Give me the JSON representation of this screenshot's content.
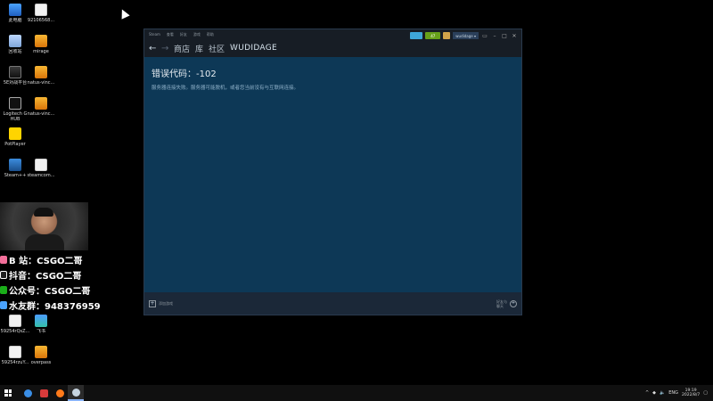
{
  "desktop": {
    "icons": [
      {
        "label": "此电脑",
        "icon": "computer-icon"
      },
      {
        "label": "92106568...",
        "icon": "document-icon"
      },
      {
        "label": "回收站",
        "icon": "recycle-bin-icon"
      },
      {
        "label": "mirage",
        "icon": "csgo-icon"
      },
      {
        "label": "5E对战平台",
        "icon": "5e-icon"
      },
      {
        "label": "natus-vinc...",
        "icon": "csgo-icon"
      },
      {
        "label": "Logitech G HUB",
        "icon": "logitech-icon"
      },
      {
        "label": "natus-vinc...",
        "icon": "csgo-icon"
      },
      {
        "label": "PotPlayer",
        "icon": "potplayer-icon"
      },
      {
        "label": "Steam++",
        "icon": "steampp-icon"
      },
      {
        "label": "steamcom...",
        "icon": "document-icon"
      },
      {
        "label": "59254rQsZ...",
        "icon": "document-icon"
      },
      {
        "label": "飞书",
        "icon": "feishu-icon"
      },
      {
        "label": "59254rzuY...",
        "icon": "document-icon"
      },
      {
        "label": "overpass",
        "icon": "csgo-icon"
      }
    ]
  },
  "steam": {
    "menu": [
      "Steam",
      "查看",
      "好友",
      "游戏",
      "帮助"
    ],
    "notification_count": "47",
    "account_name": "wudidage",
    "nav": {
      "store": "商店",
      "library": "库",
      "community": "社区",
      "username": "WUDIDAGE"
    },
    "error": {
      "title": "错误代码：-102",
      "description": "服务器连接失败。服务器可能脱机，或者您当前没有与互联网连接。"
    },
    "footer": {
      "add_game": "添加游戏",
      "friends_chat": "好友与\n聊天"
    }
  },
  "overlay": {
    "socials": [
      {
        "text": "B 站：CSGO二哥",
        "color": "#f36f9a"
      },
      {
        "text": "抖音：CSGO二哥",
        "color": "#222222"
      },
      {
        "text": "公众号：CSGO二哥",
        "color": "#1aad19"
      },
      {
        "text": "水友群：948376959",
        "color": "#4aa3ff"
      }
    ]
  },
  "taskbar": {
    "apps": [
      {
        "name": "start-button",
        "icon": "windows-icon"
      },
      {
        "name": "browser",
        "icon": "browser-icon",
        "color": "#3a8ee6"
      },
      {
        "name": "recorder",
        "icon": "recorder-icon",
        "color": "#d83b3b"
      },
      {
        "name": "firefox",
        "icon": "firefox-icon",
        "color": "#ff7a1a"
      },
      {
        "name": "steam",
        "icon": "steam-icon",
        "color": "#1b2838"
      }
    ],
    "tray": {
      "language": "ENG",
      "time": "19:19",
      "date": "2022/8/7"
    }
  }
}
